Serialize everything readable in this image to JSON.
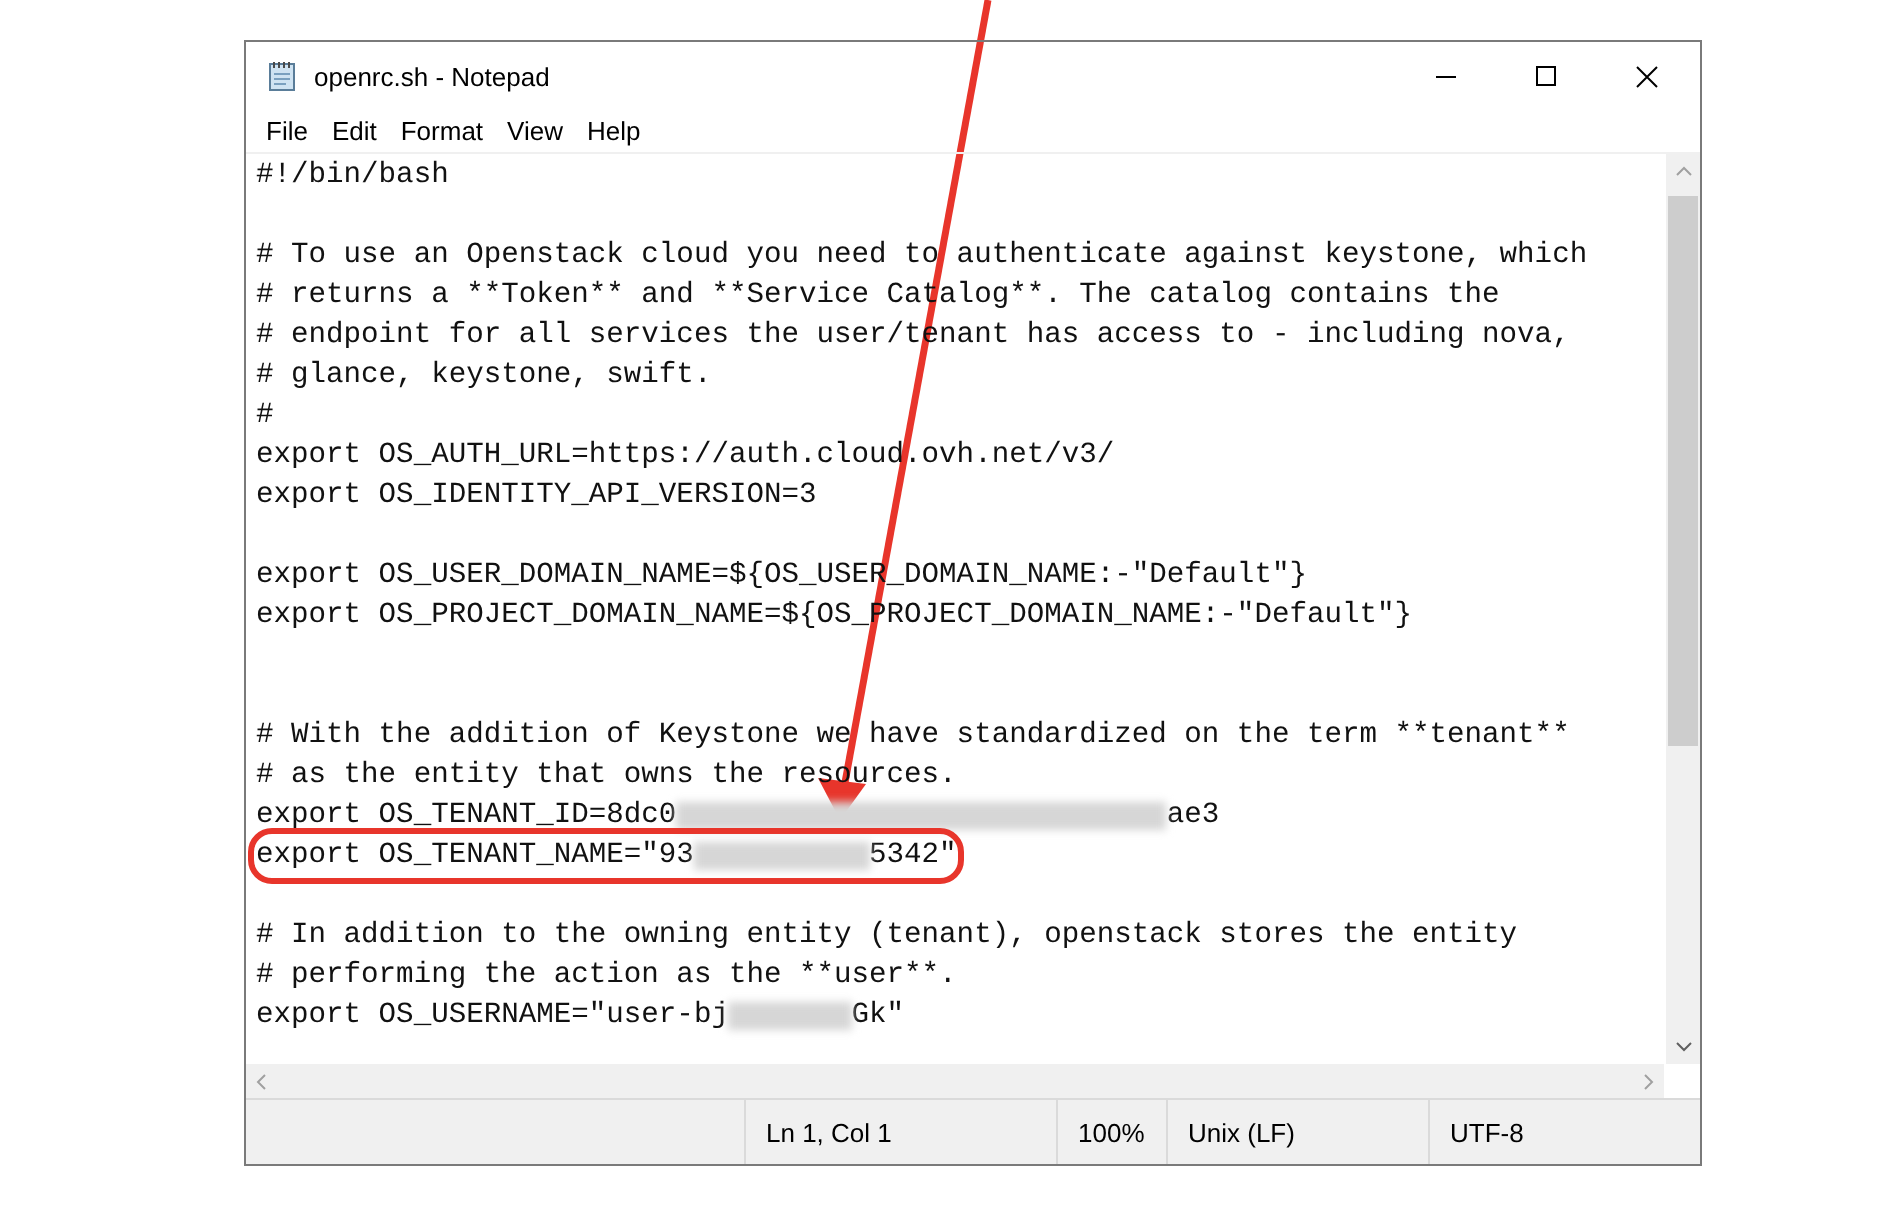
{
  "window": {
    "title": "openrc.sh - Notepad"
  },
  "menu": [
    {
      "label": "File"
    },
    {
      "label": "Edit"
    },
    {
      "label": "Format"
    },
    {
      "label": "View"
    },
    {
      "label": "Help"
    }
  ],
  "editor": {
    "lines": [
      {
        "kind": "text",
        "highlighted": false,
        "segments": [
          {
            "kind": "text",
            "text": "#!/bin/bash"
          }
        ]
      },
      {
        "kind": "blank"
      },
      {
        "kind": "text",
        "highlighted": false,
        "segments": [
          {
            "kind": "text",
            "text": "# To use an Openstack cloud you need to authenticate against keystone, which"
          }
        ]
      },
      {
        "kind": "text",
        "highlighted": false,
        "segments": [
          {
            "kind": "text",
            "text": "# returns a **Token** and **Service Catalog**. The catalog contains the"
          }
        ]
      },
      {
        "kind": "text",
        "highlighted": false,
        "segments": [
          {
            "kind": "text",
            "text": "# endpoint for all services the user/tenant has access to - including nova,"
          }
        ]
      },
      {
        "kind": "text",
        "highlighted": false,
        "segments": [
          {
            "kind": "text",
            "text": "# glance, keystone, swift."
          }
        ]
      },
      {
        "kind": "text",
        "highlighted": false,
        "segments": [
          {
            "kind": "text",
            "text": "#"
          }
        ]
      },
      {
        "kind": "text",
        "highlighted": false,
        "segments": [
          {
            "kind": "text",
            "text": "export OS_AUTH_URL=https://auth.cloud.ovh.net/v3/"
          }
        ]
      },
      {
        "kind": "text",
        "highlighted": false,
        "segments": [
          {
            "kind": "text",
            "text": "export OS_IDENTITY_API_VERSION=3"
          }
        ]
      },
      {
        "kind": "blank"
      },
      {
        "kind": "text",
        "highlighted": false,
        "segments": [
          {
            "kind": "text",
            "text": "export OS_USER_DOMAIN_NAME=${OS_USER_DOMAIN_NAME:-\"Default\"}"
          }
        ]
      },
      {
        "kind": "text",
        "highlighted": false,
        "segments": [
          {
            "kind": "text",
            "text": "export OS_PROJECT_DOMAIN_NAME=${OS_PROJECT_DOMAIN_NAME:-\"Default\"}"
          }
        ]
      },
      {
        "kind": "blank"
      },
      {
        "kind": "blank"
      },
      {
        "kind": "text",
        "highlighted": false,
        "segments": [
          {
            "kind": "text",
            "text": "# With the addition of Keystone we have standardized on the term **tenant**"
          }
        ]
      },
      {
        "kind": "text",
        "highlighted": false,
        "segments": [
          {
            "kind": "text",
            "text": "# as the entity that owns the resources."
          }
        ]
      },
      {
        "kind": "text",
        "highlighted": false,
        "segments": [
          {
            "kind": "text",
            "text": "export OS_TENANT_ID=8dc0"
          },
          {
            "kind": "blur"
          },
          {
            "kind": "text",
            "text": "ae3"
          }
        ]
      },
      {
        "kind": "text",
        "highlighted": true,
        "segments": [
          {
            "kind": "text",
            "text": "export OS_TENANT_NAME=\"93"
          },
          {
            "kind": "blur"
          },
          {
            "kind": "text",
            "text": "5342\""
          }
        ]
      },
      {
        "kind": "blank"
      },
      {
        "kind": "text",
        "highlighted": false,
        "segments": [
          {
            "kind": "text",
            "text": "# In addition to the owning entity (tenant), openstack stores the entity"
          }
        ]
      },
      {
        "kind": "text",
        "highlighted": false,
        "segments": [
          {
            "kind": "text",
            "text": "# performing the action as the **user**."
          }
        ]
      },
      {
        "kind": "text",
        "highlighted": false,
        "segments": [
          {
            "kind": "text",
            "text": "export OS_USERNAME=\"user-bj"
          },
          {
            "kind": "blur"
          },
          {
            "kind": "text",
            "text": "Gk\""
          }
        ]
      }
    ]
  },
  "status_bar": [
    "Ln 1, Col 1",
    "100%",
    "Unix (LF)",
    "UTF-8"
  ]
}
